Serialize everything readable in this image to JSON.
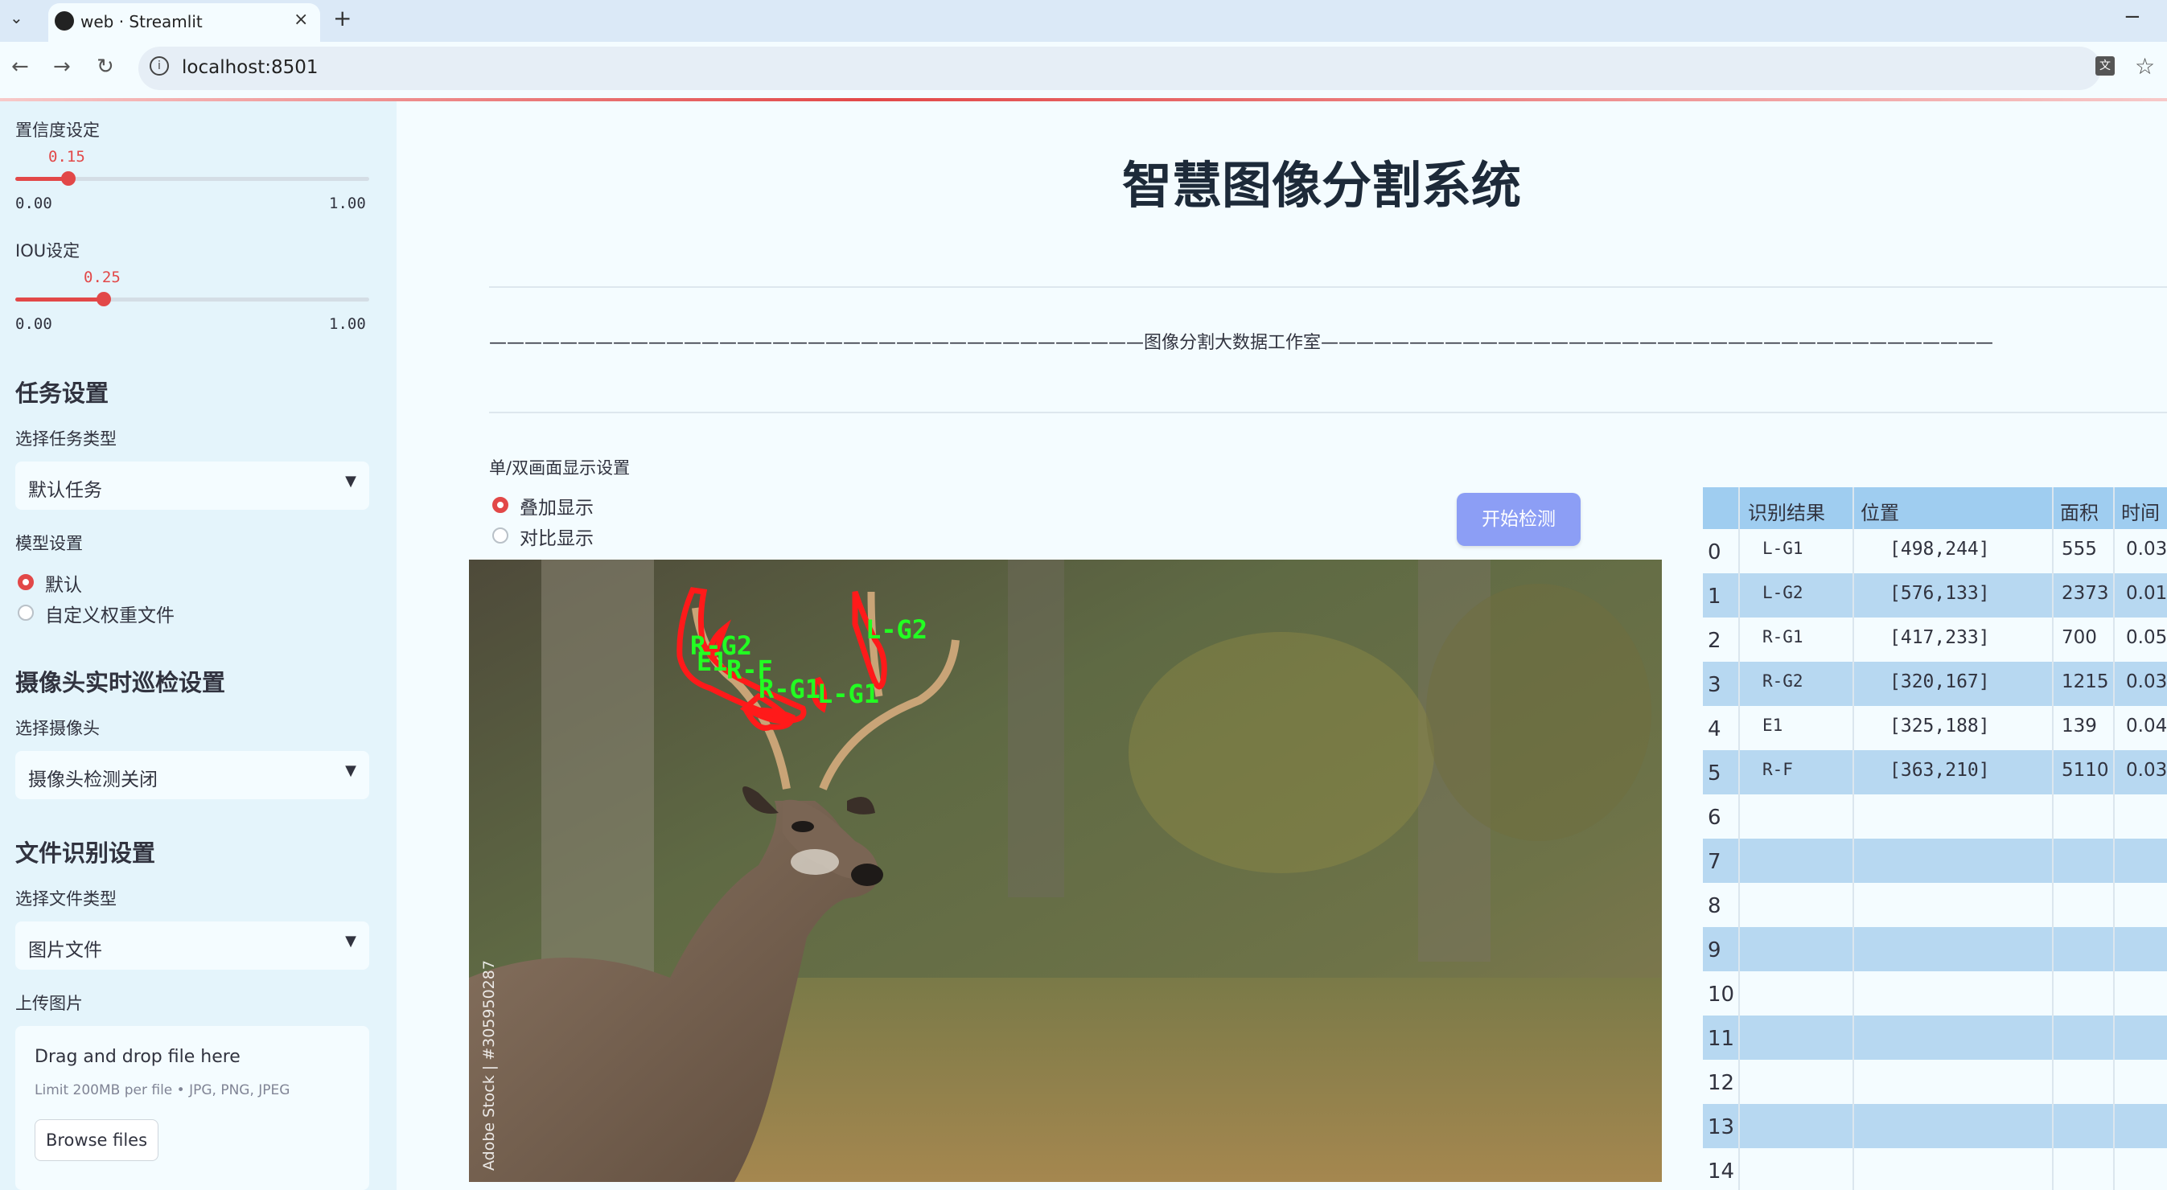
{
  "browser": {
    "tab_title": "web · Streamlit",
    "url": "localhost:8501",
    "tab_close": "×",
    "new_tab": "+",
    "minimize": "−"
  },
  "sidebar": {
    "confidence": {
      "label": "置信度设定",
      "value": "0.15",
      "min": "0.00",
      "max": "1.00",
      "fraction": 0.15
    },
    "iou": {
      "label": "IOU设定",
      "value": "0.25",
      "min": "0.00",
      "max": "1.00",
      "fraction": 0.25
    },
    "task_heading": "任务设置",
    "task_type_label": "选择任务类型",
    "task_type_value": "默认任务",
    "model_label": "模型设置",
    "model_options": [
      "默认",
      "自定义权重文件"
    ],
    "camera_heading": "摄像头实时巡检设置",
    "camera_label": "选择摄像头",
    "camera_value": "摄像头检测关闭",
    "file_heading": "文件识别设置",
    "file_type_label": "选择文件类型",
    "file_type_value": "图片文件",
    "upload_label": "上传图片",
    "upload_drag": "Drag and drop file here",
    "upload_limit": "Limit 200MB per file • JPG, PNG, JPEG",
    "browse_label": "Browse files"
  },
  "main": {
    "title": "智慧图像分割系统",
    "divider_text": "—————————————————————————————————————图像分割大数据工作室——————————————————————————————————————",
    "display_label": "单/双画面显示设置",
    "display_options": [
      "叠加显示",
      "对比显示"
    ],
    "start_button": "开始检测",
    "watermark": "Adobe Stock | #305950287",
    "detections": [
      "R-G2",
      "E1",
      "R-F",
      "R-G1",
      "L-G1",
      "L-G2"
    ]
  },
  "table": {
    "headers": [
      "识别结果",
      "位置",
      "面积",
      "时间"
    ],
    "rows": [
      {
        "idx": "0",
        "label": "L-G1",
        "pos": "[498,244]",
        "area": "555",
        "time": "0.03"
      },
      {
        "idx": "1",
        "label": "L-G2",
        "pos": "[576,133]",
        "area": "2373",
        "time": "0.01"
      },
      {
        "idx": "2",
        "label": "R-G1",
        "pos": "[417,233]",
        "area": "700",
        "time": "0.05"
      },
      {
        "idx": "3",
        "label": "R-G2",
        "pos": "[320,167]",
        "area": "1215",
        "time": "0.03"
      },
      {
        "idx": "4",
        "label": "E1",
        "pos": "[325,188]",
        "area": "139",
        "time": "0.04"
      },
      {
        "idx": "5",
        "label": "R-F",
        "pos": "[363,210]",
        "area": "5110",
        "time": "0.03"
      },
      {
        "idx": "6",
        "label": "",
        "pos": "",
        "area": "",
        "time": ""
      },
      {
        "idx": "7",
        "label": "",
        "pos": "",
        "area": "",
        "time": ""
      },
      {
        "idx": "8",
        "label": "",
        "pos": "",
        "area": "",
        "time": ""
      },
      {
        "idx": "9",
        "label": "",
        "pos": "",
        "area": "",
        "time": ""
      },
      {
        "idx": "10",
        "label": "",
        "pos": "",
        "area": "",
        "time": ""
      },
      {
        "idx": "11",
        "label": "",
        "pos": "",
        "area": "",
        "time": ""
      },
      {
        "idx": "12",
        "label": "",
        "pos": "",
        "area": "",
        "time": ""
      },
      {
        "idx": "13",
        "label": "",
        "pos": "",
        "area": "",
        "time": ""
      },
      {
        "idx": "14",
        "label": "",
        "pos": "",
        "area": "",
        "time": ""
      }
    ]
  },
  "colors": {
    "accent": "#e24848",
    "button": "#8c9ef5",
    "table_blue": "#b7d8f1",
    "mask": "#ff1a1a",
    "label_green": "#22ff22"
  }
}
